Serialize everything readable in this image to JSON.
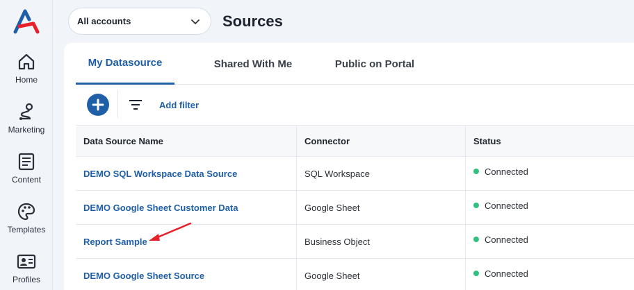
{
  "sidebar": {
    "items": [
      {
        "label": "Home",
        "icon": "home-icon"
      },
      {
        "label": "Marketing",
        "icon": "route-icon"
      },
      {
        "label": "Content",
        "icon": "document-icon"
      },
      {
        "label": "Templates",
        "icon": "palette-icon"
      },
      {
        "label": "Profiles",
        "icon": "id-card-icon"
      }
    ]
  },
  "header": {
    "account_value": "All accounts",
    "title": "Sources"
  },
  "tabs": [
    {
      "label": "My Datasource",
      "active": true
    },
    {
      "label": "Shared With Me",
      "active": false
    },
    {
      "label": "Public on Portal",
      "active": false
    }
  ],
  "toolbar": {
    "add_filter_label": "Add filter"
  },
  "table": {
    "columns": [
      "Data Source Name",
      "Connector",
      "Status"
    ],
    "rows": [
      {
        "name": "DEMO SQL Workspace Data Source",
        "connector": "SQL Workspace",
        "status": "Connected"
      },
      {
        "name": "DEMO Google Sheet Customer Data",
        "connector": "Google Sheet",
        "status": "Connected"
      },
      {
        "name": "Report Sample",
        "connector": "Business Object",
        "status": "Connected"
      },
      {
        "name": "DEMO Google Sheet Source",
        "connector": "Google Sheet",
        "status": "Connected"
      }
    ]
  },
  "colors": {
    "accent": "#1f5fa8",
    "status_connected": "#2ec27e",
    "annotation_arrow": "#e8202a"
  }
}
